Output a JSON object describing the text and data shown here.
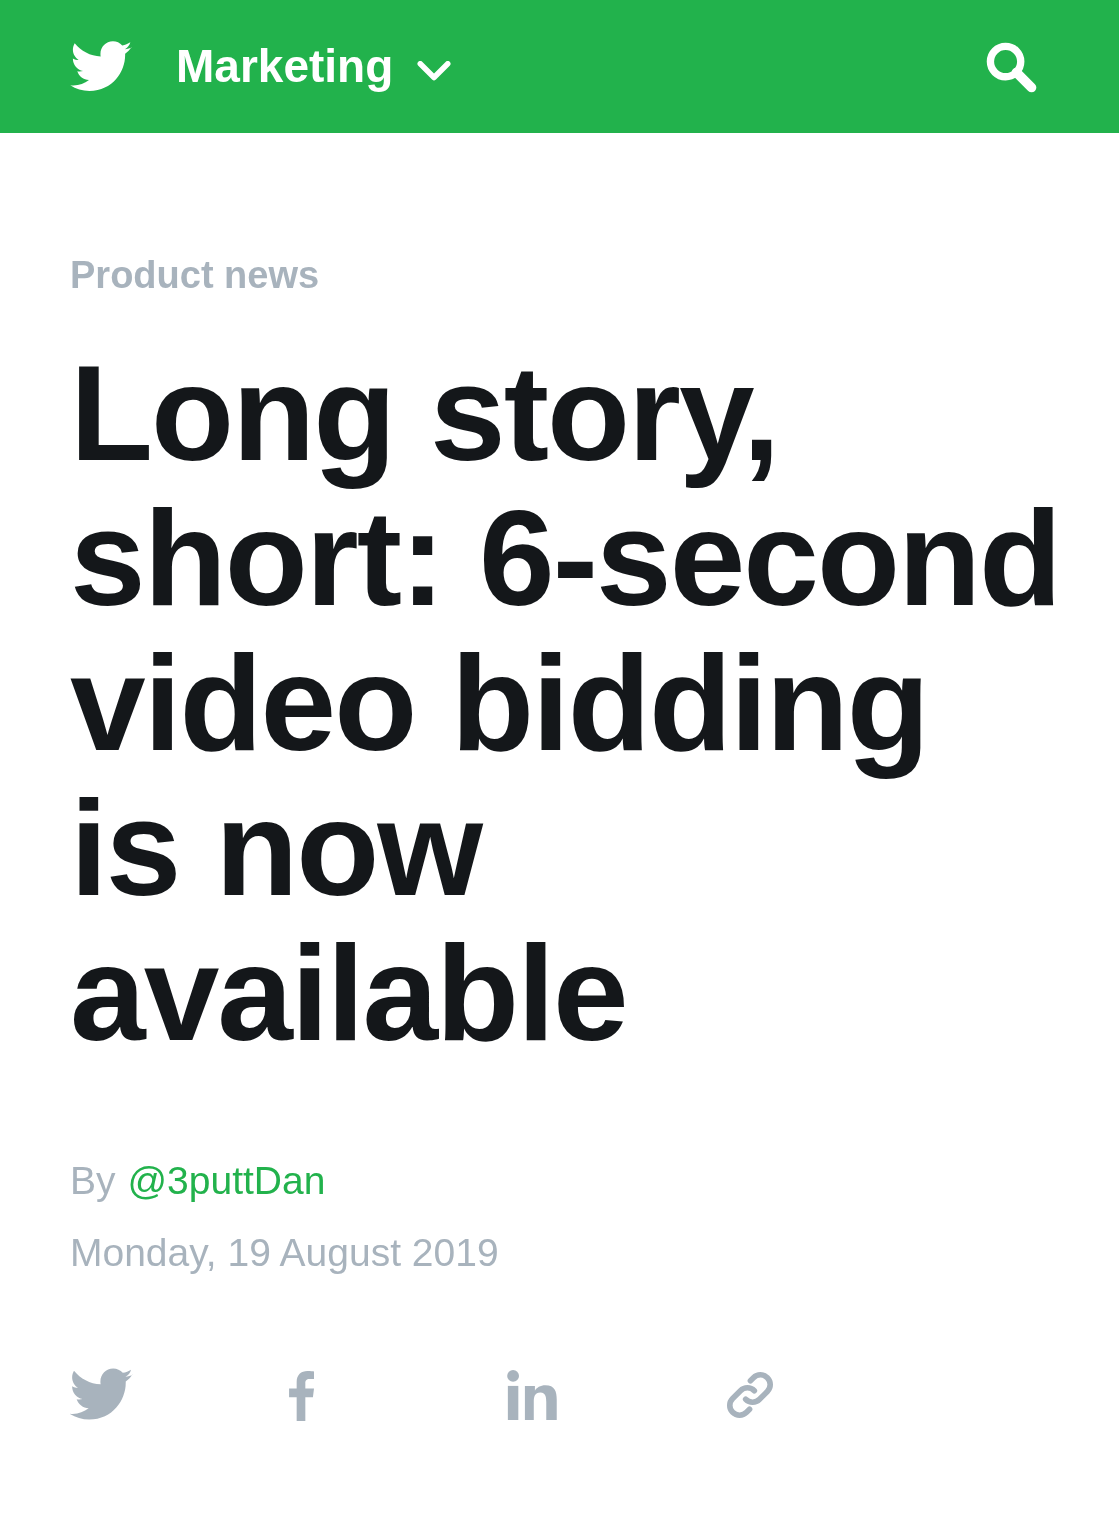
{
  "header": {
    "section": "Marketing"
  },
  "article": {
    "category": "Product news",
    "title": "Long story, short: 6-second video bidding is now available",
    "byline_prefix": "By",
    "author": "@3puttDan",
    "date": "Monday, 19 August 2019"
  },
  "share": [
    {
      "kind": "twitter"
    },
    {
      "kind": "facebook"
    },
    {
      "kind": "linkedin"
    },
    {
      "kind": "link"
    }
  ]
}
